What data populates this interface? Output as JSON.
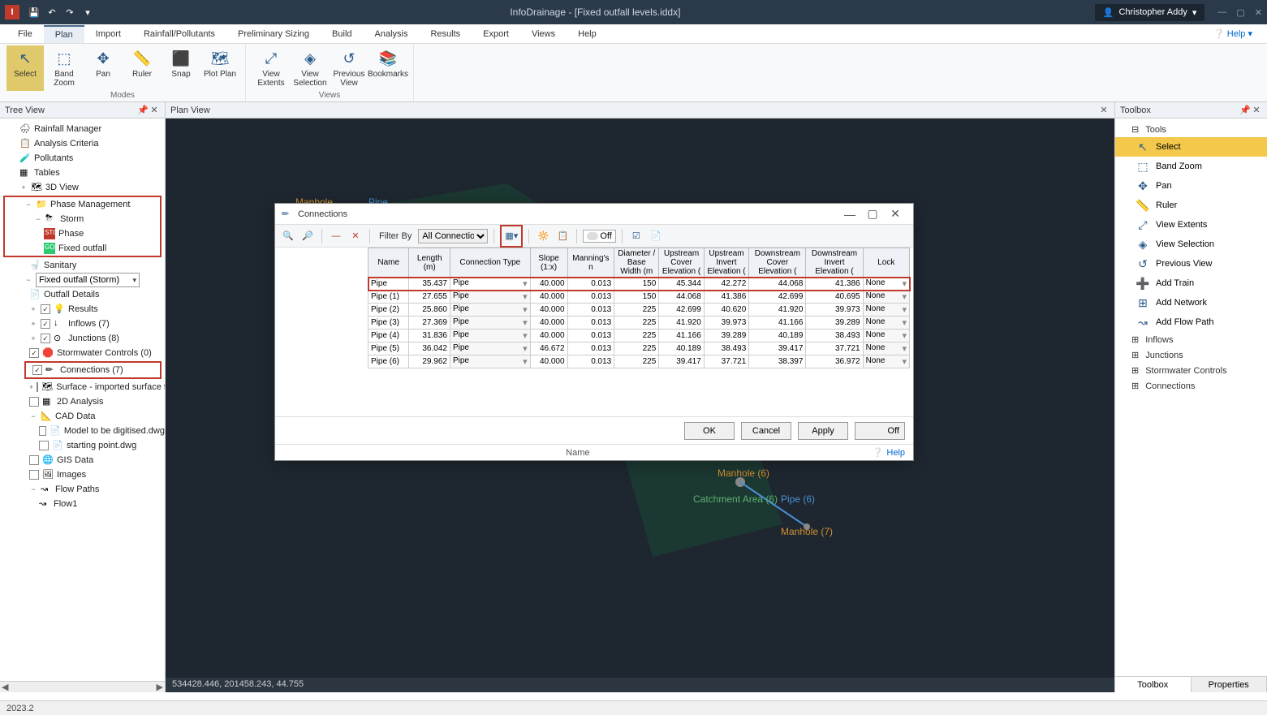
{
  "titlebar": {
    "app_initial": "I",
    "title": "InfoDrainage - [Fixed outfall levels.iddx]",
    "user": "Christopher Addy"
  },
  "menu": {
    "items": [
      "File",
      "Plan",
      "Import",
      "Rainfall/Pollutants",
      "Preliminary Sizing",
      "Build",
      "Analysis",
      "Results",
      "Export",
      "Views",
      "Help"
    ],
    "active": "Plan",
    "help_right": "Help"
  },
  "ribbon": {
    "modes_label": "Modes",
    "views_label": "Views",
    "modes": [
      {
        "label": "Select",
        "icon": "↖"
      },
      {
        "label": "Band Zoom",
        "icon": "⬚"
      },
      {
        "label": "Pan",
        "icon": "✥"
      },
      {
        "label": "Ruler",
        "icon": "📏"
      },
      {
        "label": "Snap",
        "icon": "⬛"
      },
      {
        "label": "Plot Plan",
        "icon": "🗺"
      }
    ],
    "views": [
      {
        "label": "View Extents",
        "icon": "⤢"
      },
      {
        "label": "View Selection",
        "icon": "◈"
      },
      {
        "label": "Previous View",
        "icon": "↺"
      },
      {
        "label": "Bookmarks",
        "icon": "📚"
      }
    ]
  },
  "tree": {
    "title": "Tree View",
    "items": [
      {
        "label": "Rainfall Manager",
        "lvl": 1
      },
      {
        "label": "Analysis Criteria",
        "lvl": 1
      },
      {
        "label": "Pollutants",
        "lvl": 1
      },
      {
        "label": "Tables",
        "lvl": 1
      },
      {
        "label": "3D View",
        "lvl": 1,
        "exp": "+"
      }
    ],
    "hl_group1": [
      {
        "label": "Phase Management",
        "lvl": 1,
        "exp": "−"
      },
      {
        "label": "Storm",
        "lvl": 2,
        "exp": "−"
      },
      {
        "label": "Phase",
        "lvl": 3
      },
      {
        "label": "Fixed outfall",
        "lvl": 3
      }
    ],
    "sanitary": {
      "label": "Sanitary",
      "lvl": 2
    },
    "combo": "Fixed outfall (Storm)",
    "items2": [
      {
        "label": "Outfall Details",
        "lvl": 2
      },
      {
        "label": "Results",
        "lvl": 2,
        "exp": "+",
        "chk": true
      },
      {
        "label": "Inflows (7)",
        "lvl": 2,
        "exp": "+",
        "chk": true
      },
      {
        "label": "Junctions (8)",
        "lvl": 2,
        "exp": "+",
        "chk": true
      },
      {
        "label": "Stormwater Controls (0)",
        "lvl": 2,
        "chk": true
      }
    ],
    "hl_connections": {
      "label": "Connections (7)",
      "lvl": 2,
      "chk": true
    },
    "items3": [
      {
        "label": "Surface - imported surface trimmed",
        "lvl": 2,
        "exp": "+",
        "chk": false
      },
      {
        "label": "2D Analysis",
        "lvl": 2,
        "chk": false
      },
      {
        "label": "CAD Data",
        "lvl": 2,
        "exp": "−"
      },
      {
        "label": "Model to be digitised.dwg",
        "lvl": 3,
        "chk": false
      },
      {
        "label": "starting point.dwg",
        "lvl": 3,
        "chk": false
      },
      {
        "label": "GIS Data",
        "lvl": 2,
        "chk": false
      },
      {
        "label": "Images",
        "lvl": 2,
        "chk": false
      },
      {
        "label": "Flow Paths",
        "lvl": 2,
        "exp": "−"
      },
      {
        "label": "Flow1",
        "lvl": 3
      }
    ]
  },
  "plan": {
    "title": "Plan View",
    "labels": {
      "manhole": "Manhole",
      "pipe": "Pipe",
      "catchment6": "Catchment Area (6)",
      "pipe6": "Pipe (6)",
      "manhole6": "Manhole (6)",
      "manhole7": "Manhole (7)"
    },
    "status": "534428.446, 201458.243, 44.755"
  },
  "toolbox": {
    "title": "Toolbox",
    "group_tools": "Tools",
    "items": [
      {
        "label": "Select",
        "sel": true,
        "icon": "↖"
      },
      {
        "label": "Band Zoom",
        "icon": "⬚"
      },
      {
        "label": "Pan",
        "icon": "✥"
      },
      {
        "label": "Ruler",
        "icon": "📏"
      },
      {
        "label": "View Extents",
        "icon": "⤢"
      },
      {
        "label": "View Selection",
        "icon": "◈"
      },
      {
        "label": "Previous View",
        "icon": "↺"
      },
      {
        "label": "Add Train",
        "icon": "➕"
      },
      {
        "label": "Add Network",
        "icon": "⊞"
      },
      {
        "label": "Add Flow Path",
        "icon": "↝"
      }
    ],
    "cats": [
      "Inflows",
      "Junctions",
      "Stormwater Controls",
      "Connections"
    ],
    "tabs": [
      "Toolbox",
      "Properties"
    ]
  },
  "dialog": {
    "title": "Connections",
    "filter_label": "Filter By",
    "filter_value": "All Connections",
    "toggle_off": "Off",
    "buttons": {
      "ok": "OK",
      "cancel": "Cancel",
      "apply": "Apply",
      "off": "Off"
    },
    "status_label": "Name",
    "help": "Help",
    "headers": [
      "Name",
      "Length (m)",
      "Connection Type",
      "Slope (1:x)",
      "Manning's n",
      "Diameter / Base Width (m",
      "Upstream Cover Elevation (",
      "Upstream Invert Elevation (",
      "Downstream Cover Elevation (",
      "Downstream Invert Elevation (",
      "Lock"
    ],
    "rows": [
      {
        "name": "Pipe",
        "len": "35.437",
        "type": "Pipe",
        "slope": "40.000",
        "mann": "0.013",
        "dia": "150",
        "uscov": "45.344",
        "usinv": "42.272",
        "dscov": "44.068",
        "dsinv": "41.386",
        "lock": "None"
      },
      {
        "name": "Pipe (1)",
        "len": "27.655",
        "type": "Pipe",
        "slope": "40.000",
        "mann": "0.013",
        "dia": "150",
        "uscov": "44.068",
        "usinv": "41.386",
        "dscov": "42.699",
        "dsinv": "40.695",
        "lock": "None"
      },
      {
        "name": "Pipe (2)",
        "len": "25.860",
        "type": "Pipe",
        "slope": "40.000",
        "mann": "0.013",
        "dia": "225",
        "uscov": "42.699",
        "usinv": "40.620",
        "dscov": "41.920",
        "dsinv": "39.973",
        "lock": "None"
      },
      {
        "name": "Pipe (3)",
        "len": "27.369",
        "type": "Pipe",
        "slope": "40.000",
        "mann": "0.013",
        "dia": "225",
        "uscov": "41.920",
        "usinv": "39.973",
        "dscov": "41.166",
        "dsinv": "39.289",
        "lock": "None"
      },
      {
        "name": "Pipe (4)",
        "len": "31.836",
        "type": "Pipe",
        "slope": "40.000",
        "mann": "0.013",
        "dia": "225",
        "uscov": "41.166",
        "usinv": "39.289",
        "dscov": "40.189",
        "dsinv": "38.493",
        "lock": "None"
      },
      {
        "name": "Pipe (5)",
        "len": "36.042",
        "type": "Pipe",
        "slope": "46.672",
        "mann": "0.013",
        "dia": "225",
        "uscov": "40.189",
        "usinv": "38.493",
        "dscov": "39.417",
        "dsinv": "37.721",
        "lock": "None"
      },
      {
        "name": "Pipe (6)",
        "len": "29.962",
        "type": "Pipe",
        "slope": "40.000",
        "mann": "0.013",
        "dia": "225",
        "uscov": "39.417",
        "usinv": "37.721",
        "dscov": "38.397",
        "dsinv": "36.972",
        "lock": "None"
      }
    ]
  },
  "statusbar": {
    "version": "2023.2"
  }
}
